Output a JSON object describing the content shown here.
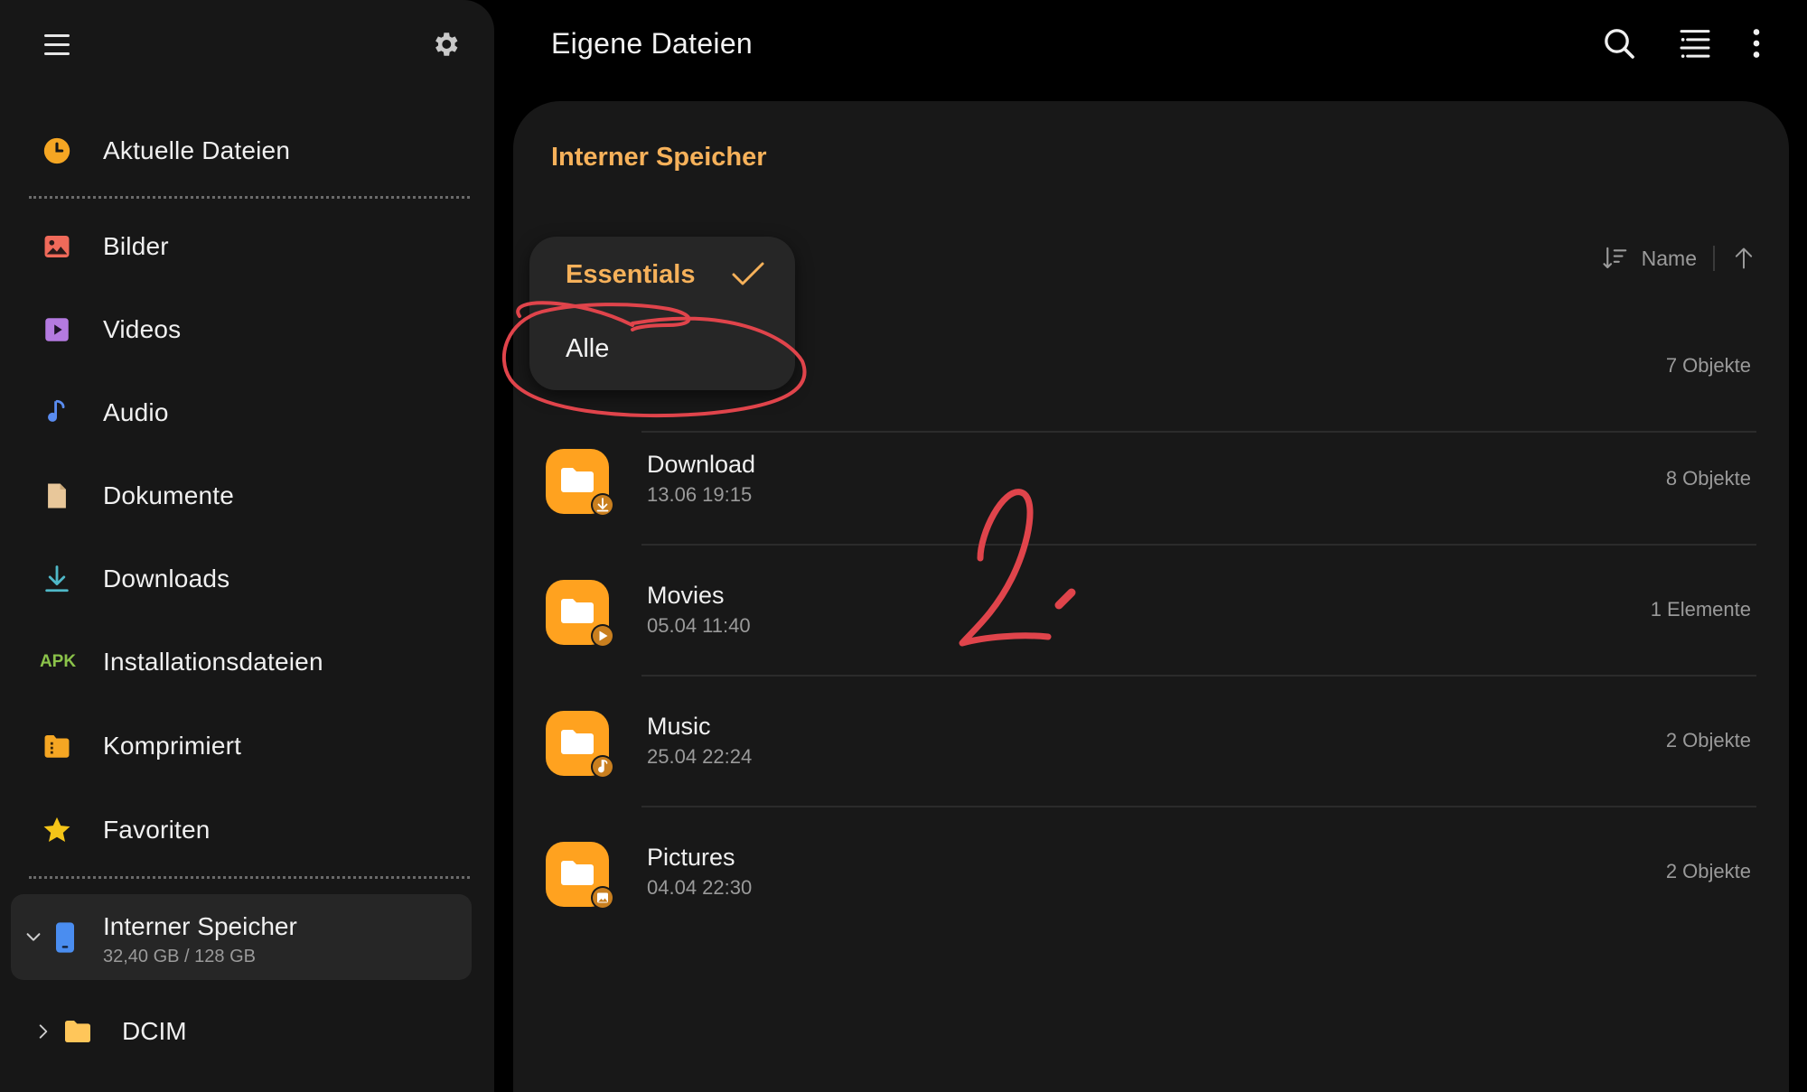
{
  "sidebar": {
    "items": [
      {
        "label": "Aktuelle Dateien",
        "icon": "clock-icon",
        "color": "#f5a623"
      },
      {
        "label": "Bilder",
        "icon": "image-icon",
        "color": "#f06a5a"
      },
      {
        "label": "Videos",
        "icon": "video-icon",
        "color": "#b47ae0"
      },
      {
        "label": "Audio",
        "icon": "music-note-icon",
        "color": "#5a8cf0"
      },
      {
        "label": "Dokumente",
        "icon": "document-icon",
        "color": "#e8c79a"
      },
      {
        "label": "Downloads",
        "icon": "download-icon",
        "color": "#4fb8c8"
      },
      {
        "label": "Installationsdateien",
        "icon": "apk-icon",
        "color": "#8bc34a"
      },
      {
        "label": "Komprimiert",
        "icon": "archive-icon",
        "color": "#f5a623"
      },
      {
        "label": "Favoriten",
        "icon": "star-icon",
        "color": "#f5c518"
      }
    ],
    "apk_text": "APK",
    "storage": {
      "title": "Interner Speicher",
      "usage": "32,40 GB / 128 GB",
      "icon": "phone-icon"
    },
    "folder": {
      "label": "DCIM",
      "icon": "folder-icon"
    }
  },
  "header": {
    "title": "Eigene Dateien",
    "actions": [
      "search-icon",
      "filter-list-icon",
      "more-vert-icon"
    ]
  },
  "main": {
    "breadcrumb": "Interner Speicher",
    "sort": {
      "label": "Name",
      "direction": "ascending"
    },
    "filter": {
      "selected": "Essentials",
      "options": [
        "Alle"
      ]
    },
    "rows": [
      {
        "name": "",
        "date": "",
        "count": "7 Objekte",
        "badge": "none"
      },
      {
        "name": "Download",
        "date": "13.06 19:15",
        "count": "8 Objekte",
        "badge": "download-badge-icon"
      },
      {
        "name": "Movies",
        "date": "05.04 11:40",
        "count": "1 Elemente",
        "badge": "play-badge-icon"
      },
      {
        "name": "Music",
        "date": "25.04 22:24",
        "count": "2 Objekte",
        "badge": "music-badge-icon"
      },
      {
        "name": "Pictures",
        "date": "04.04 22:30",
        "count": "2 Objekte",
        "badge": "image-badge-icon"
      }
    ]
  },
  "colors": {
    "accent": "#f6b15a",
    "folder": "#ffa21f",
    "annotation": "#e0444b"
  }
}
